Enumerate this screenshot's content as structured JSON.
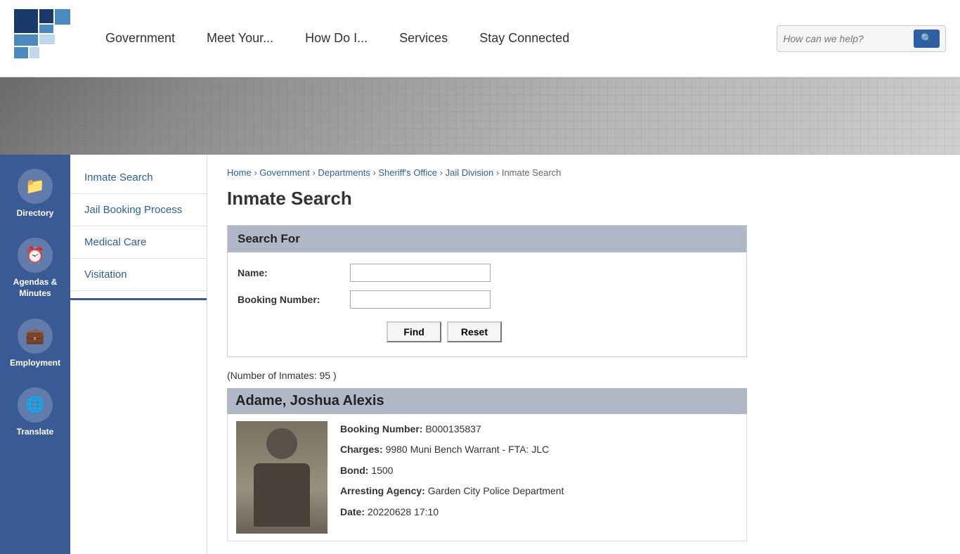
{
  "header": {
    "search_placeholder": "How can we help?",
    "nav_items": [
      {
        "label": "Government",
        "id": "government"
      },
      {
        "label": "Meet Your...",
        "id": "meet-your"
      },
      {
        "label": "How Do I...",
        "id": "how-do-i"
      },
      {
        "label": "Services",
        "id": "services"
      },
      {
        "label": "Stay Connected",
        "id": "stay-connected"
      }
    ]
  },
  "icon_sidebar": {
    "items": [
      {
        "label": "Directory",
        "icon": "📁",
        "id": "directory"
      },
      {
        "label": "Agendas & Minutes",
        "icon": "⏱",
        "id": "agendas-minutes"
      },
      {
        "label": "Employment",
        "icon": "💼",
        "id": "employment"
      },
      {
        "label": "Translate",
        "icon": "🌐",
        "id": "translate"
      }
    ]
  },
  "nav_sidebar": {
    "items": [
      {
        "label": "Inmate Search",
        "href": "#",
        "active": true
      },
      {
        "label": "Jail Booking Process",
        "href": "#"
      },
      {
        "label": "Medical Care",
        "href": "#"
      },
      {
        "label": "Visitation",
        "href": "#"
      }
    ]
  },
  "breadcrumb": {
    "items": [
      {
        "label": "Home",
        "href": "#"
      },
      {
        "label": "Government",
        "href": "#"
      },
      {
        "label": "Departments",
        "href": "#"
      },
      {
        "label": "Sheriff's Office",
        "href": "#"
      },
      {
        "label": "Jail Division",
        "href": "#"
      },
      {
        "label": "Inmate Search",
        "href": null
      }
    ]
  },
  "page": {
    "title": "Inmate Search"
  },
  "search_form": {
    "header": "Search For",
    "name_label": "Name:",
    "booking_label": "Booking Number:",
    "find_button": "Find",
    "reset_button": "Reset"
  },
  "results": {
    "count_text": "(Number of Inmates: 95 )",
    "inmates": [
      {
        "name": "Adame, Joshua Alexis",
        "booking_number": "B000135837",
        "charges": "9980 Muni Bench Warrant - FTA: JLC",
        "bond": "1500",
        "arresting_agency": "Garden City Police Department",
        "date": "20220628 17:10"
      }
    ]
  },
  "labels": {
    "booking_number": "Booking Number:",
    "charges": "Charges:",
    "bond": "Bond:",
    "arresting_agency": "Arresting Agency:",
    "date": "Date:"
  }
}
